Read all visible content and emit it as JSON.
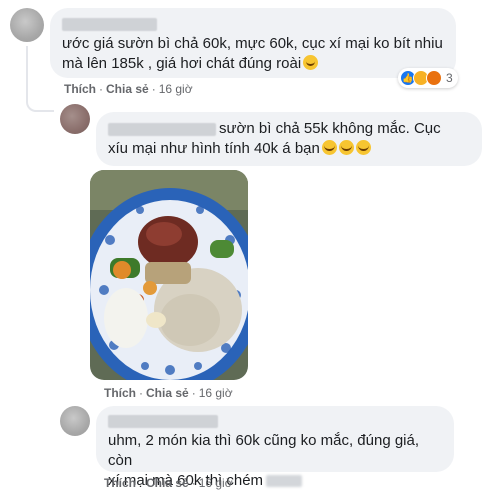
{
  "comments": [
    {
      "text": "ước giá sườn bì chả 60k, mực 60k, cục xí mại ko bít nhiu mà lên 185k , giá hơi chát đúng roài",
      "actions": {
        "like": "Thích",
        "share": "Chia sẻ",
        "time": "16 giờ"
      },
      "reactions": {
        "icons": [
          "like-icon",
          "haha-icon",
          "angry-icon"
        ],
        "count": "3"
      }
    },
    {
      "text_first": "sườn bì chả 55k không mắc. Cục",
      "text_second": "xíu mại như hình tính 40k á bạn",
      "actions": {
        "like": "Thích",
        "share": "Chia sẻ",
        "time": "16 giờ"
      }
    },
    {
      "text_first": "uhm, 2 món kia thì 60k cũng ko mắc, đúng giá, còn",
      "text_second": "xí mại mà 60k thì chém",
      "actions": {
        "like": "Thích",
        "share": "Chia sẻ",
        "time": "16 giờ"
      }
    }
  ],
  "colors": {
    "bubble": "#f0f2f5",
    "meta": "#65676b",
    "like": "#1877f2"
  }
}
